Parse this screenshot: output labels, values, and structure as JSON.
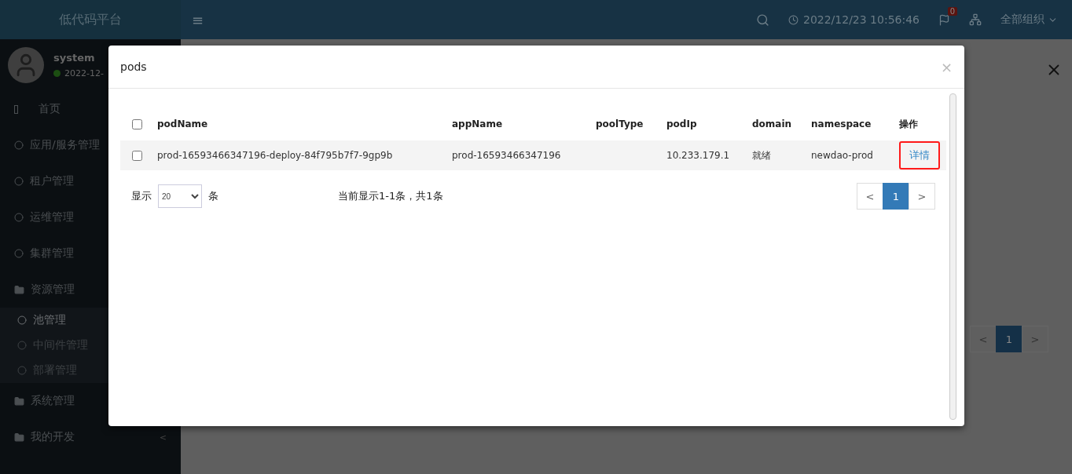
{
  "app": {
    "logo": "低代码平台",
    "menu_toggle": "≡",
    "datetime": "2022/12/23 10:56:46",
    "notification_count": "0",
    "org_selector": "全部组织"
  },
  "user": {
    "name": "system",
    "online": true,
    "date": "2022-12-"
  },
  "sidebar": {
    "items": [
      {
        "label": "首页",
        "kind": "page"
      },
      {
        "label": "应用/服务管理",
        "kind": "circle"
      },
      {
        "label": "租户管理",
        "kind": "circle"
      },
      {
        "label": "运维管理",
        "kind": "circle"
      },
      {
        "label": "集群管理",
        "kind": "circle"
      },
      {
        "label": "资源管理",
        "kind": "folder",
        "children": [
          {
            "label": "池管理",
            "selected": true
          },
          {
            "label": "中间件管理",
            "selected": false
          },
          {
            "label": "部署管理",
            "selected": false
          }
        ]
      },
      {
        "label": "系统管理",
        "kind": "folder"
      },
      {
        "label": "我的开发",
        "kind": "folder"
      }
    ],
    "collapse": "<"
  },
  "background": {
    "pagination": [
      {
        "label": "<",
        "selected": false
      },
      {
        "label": "1",
        "selected": true
      },
      {
        "label": ">",
        "selected": false
      }
    ]
  },
  "dialog": {
    "title": "pods",
    "close": "×",
    "table": {
      "header_checked": false,
      "columns": [
        "podName",
        "appName",
        "poolType",
        "podIp",
        "domain",
        "namespace",
        "操作"
      ],
      "rows": [
        {
          "checked": false,
          "cells": [
            "prod-16593466347196-deploy-84f795b7f7-9gp9b",
            "prod-16593466347196",
            "",
            "10.233.179.1",
            "就绪",
            "newdao-prod"
          ],
          "action": "详情",
          "highlighted": true
        }
      ]
    },
    "page_size_label": "显示",
    "page_size": "20",
    "page_size_unit": "条",
    "summary": "当前显示1-1条，共1条",
    "pagination": [
      {
        "label": "<",
        "selected": false
      },
      {
        "label": "1",
        "selected": true
      },
      {
        "label": ">",
        "selected": false
      }
    ]
  }
}
